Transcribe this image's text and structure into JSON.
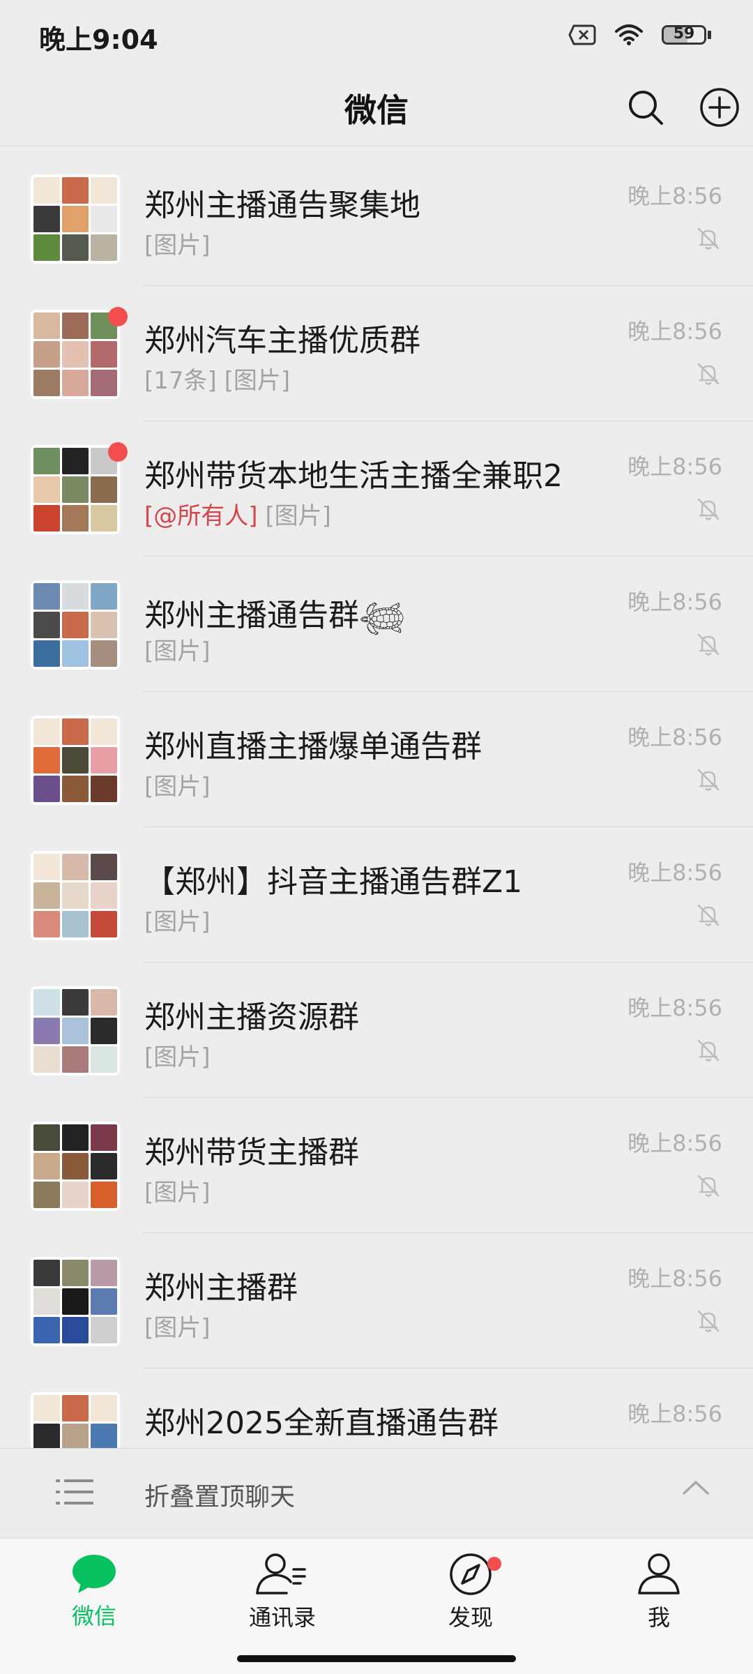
{
  "status_bar": {
    "time": "晚上9:04",
    "battery": "59",
    "battery_level": 0.59
  },
  "header": {
    "title": "微信"
  },
  "chats": [
    {
      "name": "郑州主播通告聚集地",
      "preview_mention": "",
      "preview": "[图片]",
      "time": "晚上8:56",
      "unread_dot": false,
      "avatar_colors": [
        "#f2e6d9",
        "#c96a4a",
        "#f2e6d9",
        "#3a3a3a",
        "#e0a26a",
        "#e8e8ea",
        "#5f8a3d",
        "#555a50",
        "#b9b2a3"
      ]
    },
    {
      "name": "郑州汽车主播优质群",
      "preview_mention": "",
      "preview": "[17条] [图片]",
      "time": "晚上8:56",
      "unread_dot": true,
      "avatar_colors": [
        "#d9b7a1",
        "#9c6b58",
        "#6f8f5a",
        "#c7a08a",
        "#e2c1b1",
        "#b46a6a",
        "#9d7b62",
        "#d8a89a",
        "#a36b73"
      ]
    },
    {
      "name": "郑州带货本地生活主播全兼职2",
      "preview_mention": "[@所有人]",
      "preview": "[图片]",
      "time": "晚上8:56",
      "unread_dot": true,
      "avatar_colors": [
        "#6f9060",
        "#222222",
        "#c9c9c9",
        "#e9c8a9",
        "#7c8a63",
        "#8a6b4e",
        "#c9432f",
        "#a5785a",
        "#d8c9a2"
      ]
    },
    {
      "name": "郑州主播通告群𓆉",
      "preview_mention": "",
      "preview": "[图片]",
      "time": "晚上8:56",
      "unread_dot": false,
      "avatar_colors": [
        "#6d8ab2",
        "#d7dbe0",
        "#7fa6c4",
        "#4a4a4a",
        "#c96a4a",
        "#d9c3b0",
        "#3d6f9e",
        "#9fc3e0",
        "#a58d80"
      ]
    },
    {
      "name": "郑州直播主播爆单通告群",
      "preview_mention": "",
      "preview": "[图片]",
      "time": "晚上8:56",
      "unread_dot": false,
      "avatar_colors": [
        "#f2e6d9",
        "#c96a4a",
        "#f2e6d9",
        "#e06a3a",
        "#4d4a3a",
        "#e8a0a8",
        "#6a4f8a",
        "#8a5a3a",
        "#6a3a2a"
      ]
    },
    {
      "name": "【郑州】抖音主播通告群Z1",
      "preview_mention": "",
      "preview": "[图片]",
      "time": "晚上8:56",
      "unread_dot": false,
      "avatar_colors": [
        "#f2e6d9",
        "#d7b9a9",
        "#5a4a4a",
        "#c9b39a",
        "#e6d9c9",
        "#e8d2c9",
        "#d98a7a",
        "#a9c2d2",
        "#c44a3a"
      ]
    },
    {
      "name": "郑州主播资源群",
      "preview_mention": "",
      "preview": "[图片]",
      "time": "晚上8:56",
      "unread_dot": false,
      "avatar_colors": [
        "#cfe0e8",
        "#3a3a3a",
        "#d8b9a9",
        "#8a7ab0",
        "#a9c2d9",
        "#2a2a2a",
        "#e8ddd0",
        "#a97a7a",
        "#d9e6e0"
      ]
    },
    {
      "name": "郑州带货主播群",
      "preview_mention": "",
      "preview": "[图片]",
      "time": "晚上8:56",
      "unread_dot": false,
      "avatar_colors": [
        "#4a4a3a",
        "#222222",
        "#7a3a4a",
        "#c9a98a",
        "#8a5a3a",
        "#2a2a2a",
        "#8a7a5a",
        "#e8d2c9",
        "#d9602a"
      ]
    },
    {
      "name": "郑州主播群",
      "preview_mention": "",
      "preview": "[图片]",
      "time": "晚上8:56",
      "unread_dot": false,
      "avatar_colors": [
        "#3a3a3a",
        "#8a8a6a",
        "#b99aa9",
        "#e0ddd8",
        "#1a1a1a",
        "#5a7ab0",
        "#3a66b0",
        "#2a4a9a",
        "#cfcfcf"
      ]
    },
    {
      "name": "郑州2025全新直播通告群",
      "preview_mention": "",
      "preview": "",
      "time": "晚上8:56",
      "unread_dot": false,
      "avatar_colors": [
        "#f2e6d9",
        "#c96a4a",
        "#f2e6d9",
        "#2a2a2a",
        "#b9a28a",
        "#4a7ab0",
        "#e8e8e8",
        "#e8e8e8",
        "#e8e8e8"
      ]
    }
  ],
  "fold_bar": {
    "label": "折叠置顶聊天"
  },
  "tabs": [
    {
      "label": "微信",
      "icon": "chat-bubble-icon",
      "active": true,
      "dot": false
    },
    {
      "label": "通讯录",
      "icon": "contacts-icon",
      "active": false,
      "dot": false
    },
    {
      "label": "发现",
      "icon": "compass-icon",
      "active": false,
      "dot": true
    },
    {
      "label": "我",
      "icon": "person-icon",
      "active": false,
      "dot": false
    }
  ],
  "colors": {
    "accent": "#07c160",
    "badge": "#f24e4e",
    "mention": "#d6454a"
  }
}
